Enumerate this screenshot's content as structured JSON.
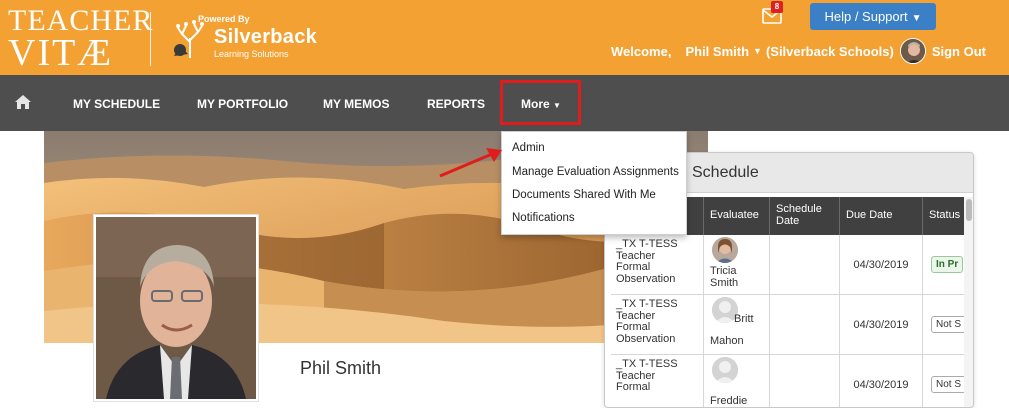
{
  "header": {
    "logo_line1": "TEACHER",
    "logo_line2": "VITÆ",
    "powered_by": "Powered By",
    "partner_brand": "Silverback",
    "partner_tagline": "Learning Solutions",
    "mail_count": "8",
    "help_label": "Help / Support",
    "welcome": "Welcome,",
    "user_name": "Phil Smith",
    "organization": "(Silverback Schools)",
    "sign_out": "Sign Out"
  },
  "nav": {
    "items": [
      {
        "label": "MY SCHEDULE"
      },
      {
        "label": "MY PORTFOLIO"
      },
      {
        "label": "MY MEMOS"
      },
      {
        "label": "REPORTS"
      }
    ],
    "more_label": "More"
  },
  "more_menu": {
    "items": [
      {
        "label": "Admin"
      },
      {
        "label": "Manage Evaluation Assignments"
      },
      {
        "label": "Documents Shared With Me"
      },
      {
        "label": "Notifications"
      }
    ]
  },
  "profile": {
    "name": "Phil Smith"
  },
  "schedule": {
    "title_visible": "Schedule",
    "columns": [
      "Evaluatee",
      "Schedule Date",
      "Due Date",
      "Status"
    ],
    "rows": [
      {
        "eval_type": [
          "_TX T-TESS",
          "Teacher",
          "Formal",
          "Observation"
        ],
        "evaluatee": [
          "Tricia",
          "Smith"
        ],
        "schedule_date": "",
        "due_date": "04/30/2019",
        "status": "In Pr"
      },
      {
        "eval_type": [
          "_TX T-TESS",
          "Teacher",
          "Formal",
          "Observation"
        ],
        "evaluatee": [
          "Britt",
          "Mahon"
        ],
        "schedule_date": "",
        "due_date": "04/30/2019",
        "status": "Not S"
      },
      {
        "eval_type": [
          "_TX T-TESS",
          "Teacher",
          "Formal"
        ],
        "evaluatee": [
          "Freddie"
        ],
        "schedule_date": "",
        "due_date": "04/30/2019",
        "status": "Not S"
      }
    ]
  },
  "colors": {
    "header_orange": "#f4a133",
    "nav_dark": "#4e4e4e",
    "help_blue": "#3b80c6",
    "highlight_red": "#e01d1d"
  }
}
